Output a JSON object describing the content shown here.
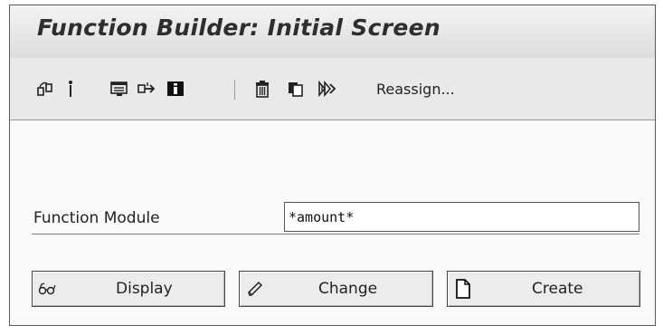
{
  "window": {
    "title": "Function Builder: Initial Screen"
  },
  "toolbar": {
    "icons": [
      "other-object-icon",
      "where-used-icon",
      "display-object-list-icon",
      "navigate-icon",
      "information-icon",
      "delete-icon",
      "copy-icon",
      "rename-icon"
    ],
    "reassign_label": "Reassign..."
  },
  "form": {
    "function_module_label": "Function Module",
    "function_module_value": "*amount*"
  },
  "buttons": {
    "display_label": "Display",
    "change_label": "Change",
    "create_label": "Create"
  }
}
